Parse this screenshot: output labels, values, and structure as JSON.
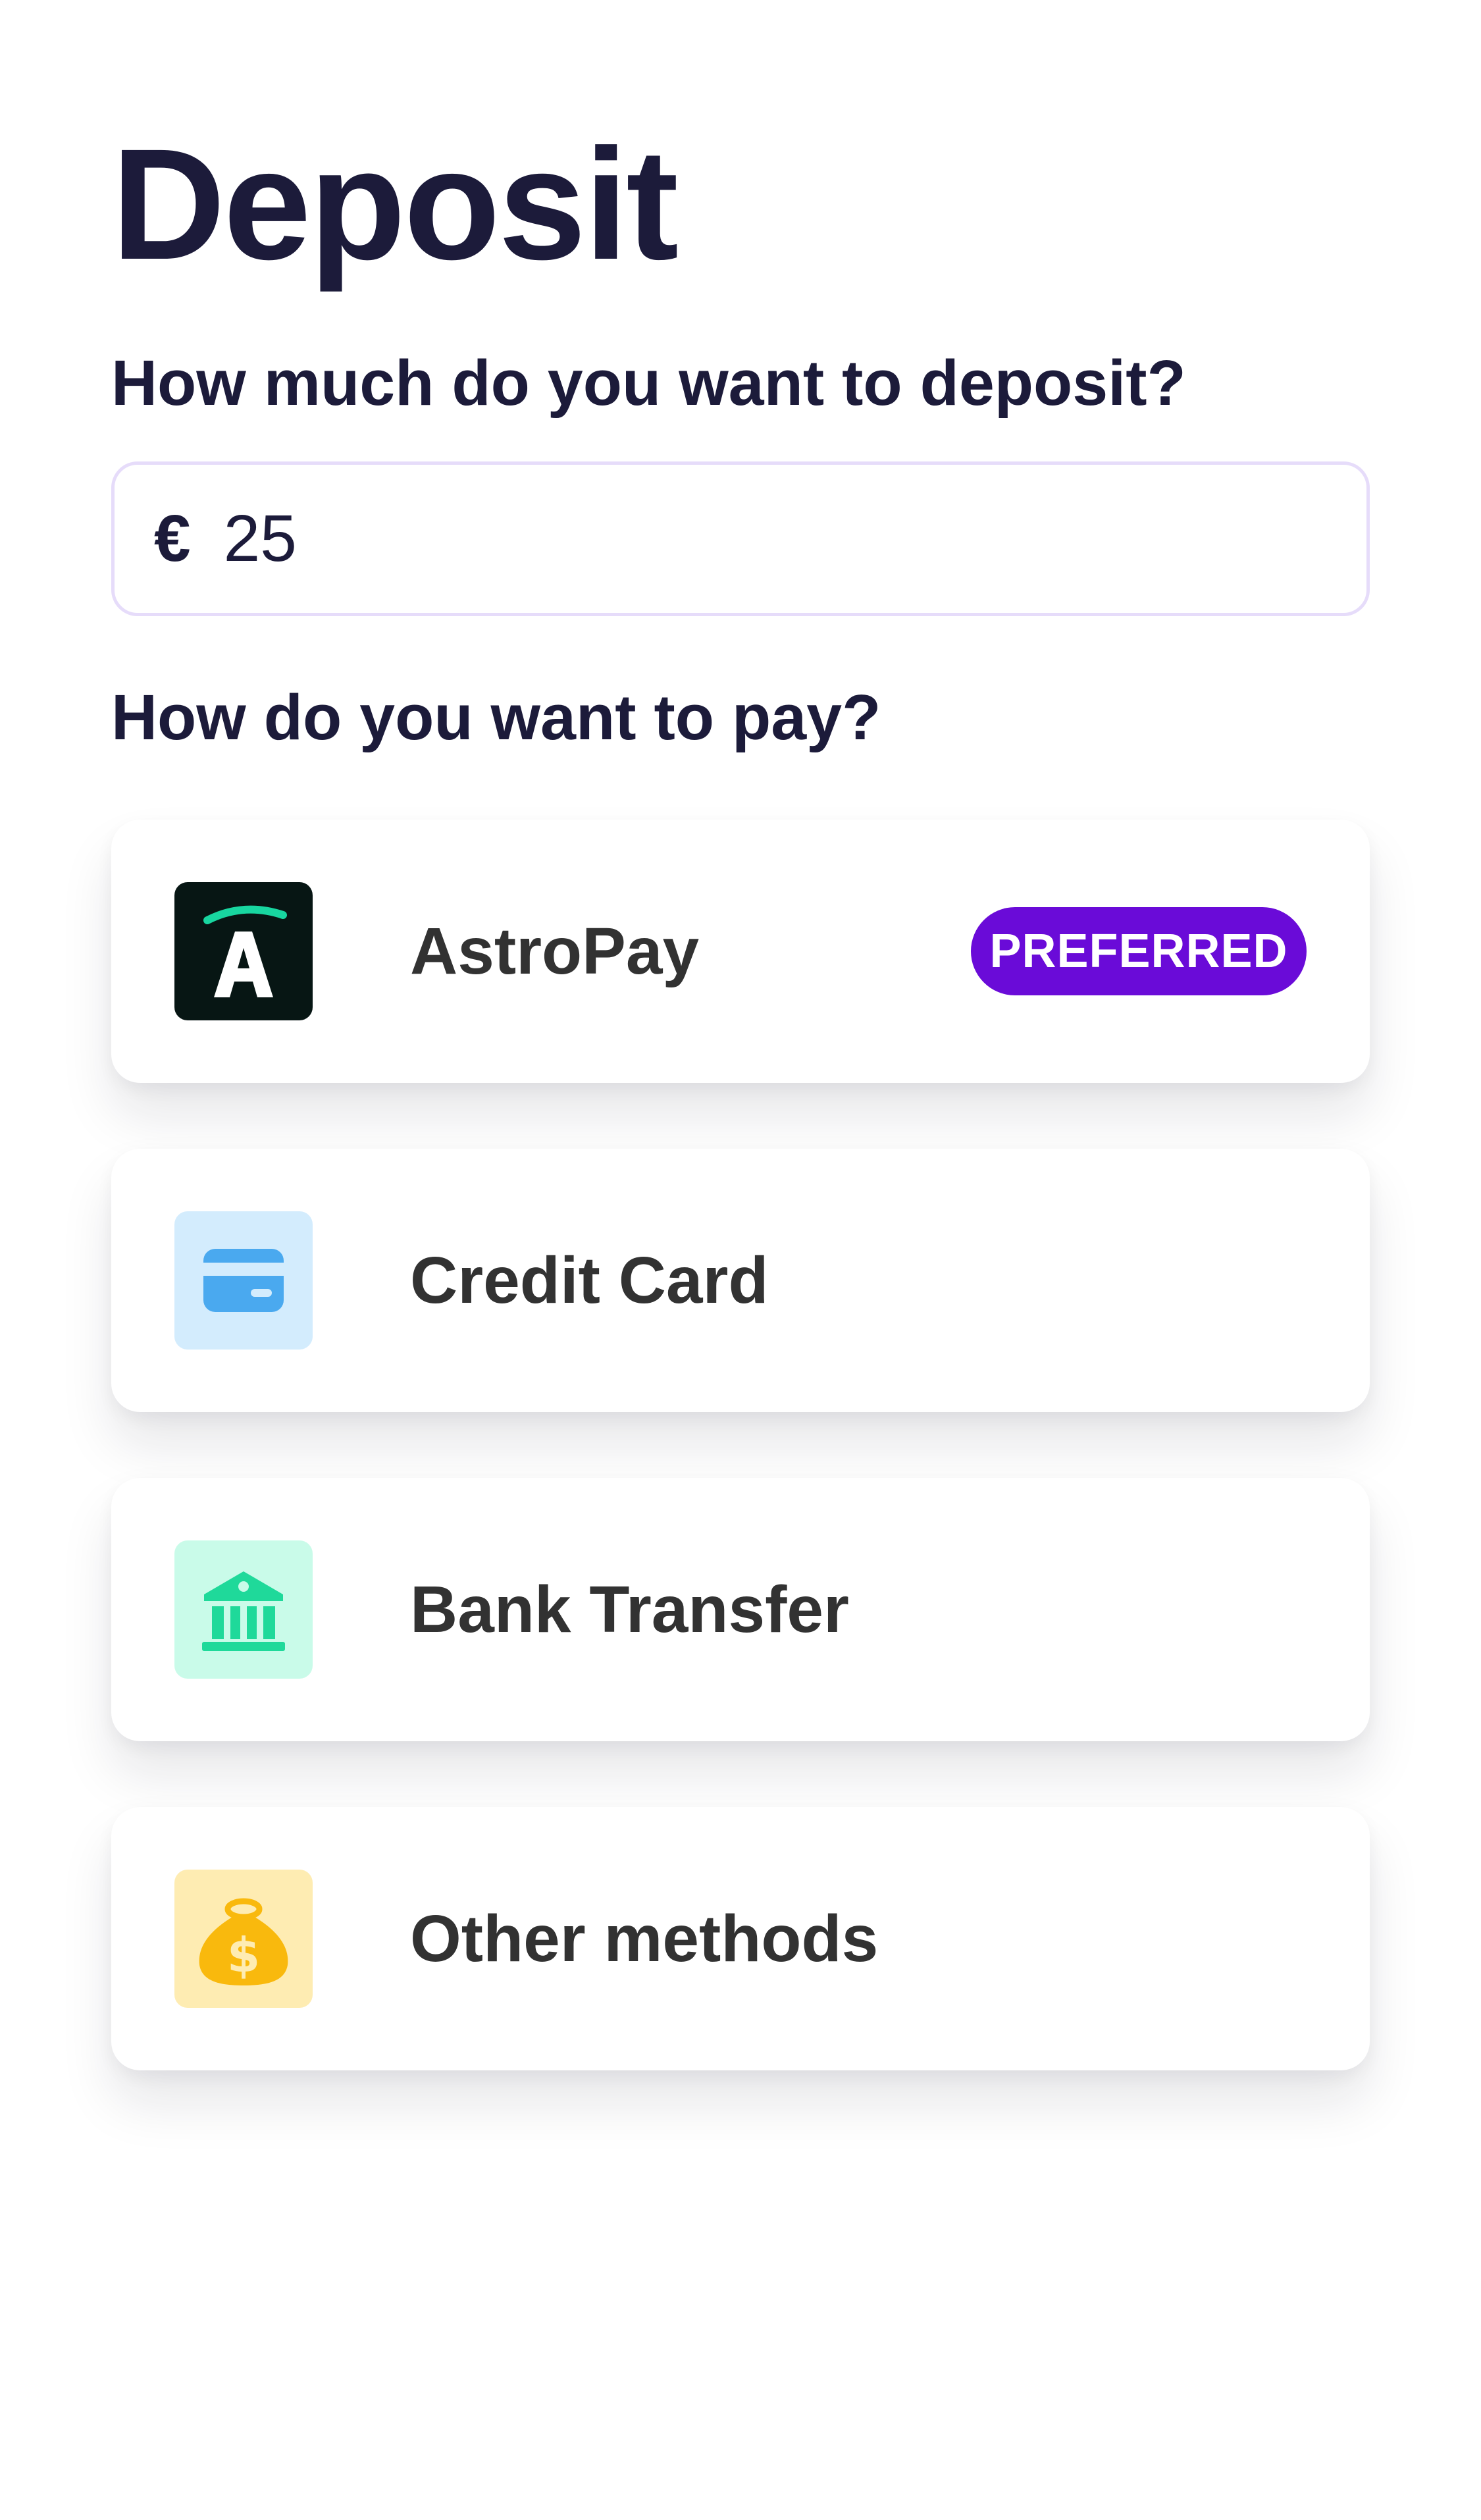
{
  "page": {
    "title": "Deposit"
  },
  "amount": {
    "question": "How much do you want to deposit?",
    "currency_symbol": "€",
    "value": "25"
  },
  "payment": {
    "question": "How do you want to pay?",
    "methods": [
      {
        "label": "AstroPay",
        "icon": "astropay-logo",
        "badge": "PREFERRED",
        "icon_bg": "#071614",
        "accent": "#18d6a0"
      },
      {
        "label": "Credit Card",
        "icon": "credit-card-icon",
        "icon_bg": "#d3ecfd",
        "accent": "#4aa9ef"
      },
      {
        "label": "Bank Transfer",
        "icon": "bank-icon",
        "icon_bg": "#c9fbe9",
        "accent": "#1fd99a"
      },
      {
        "label": "Other methods",
        "icon": "money-bag-icon",
        "icon_bg": "#feecb2",
        "accent": "#f9b90d"
      }
    ]
  },
  "colors": {
    "heading": "#1c1b3a",
    "badge_bg": "#6a0bd8",
    "input_border": "#e6dcfa"
  }
}
